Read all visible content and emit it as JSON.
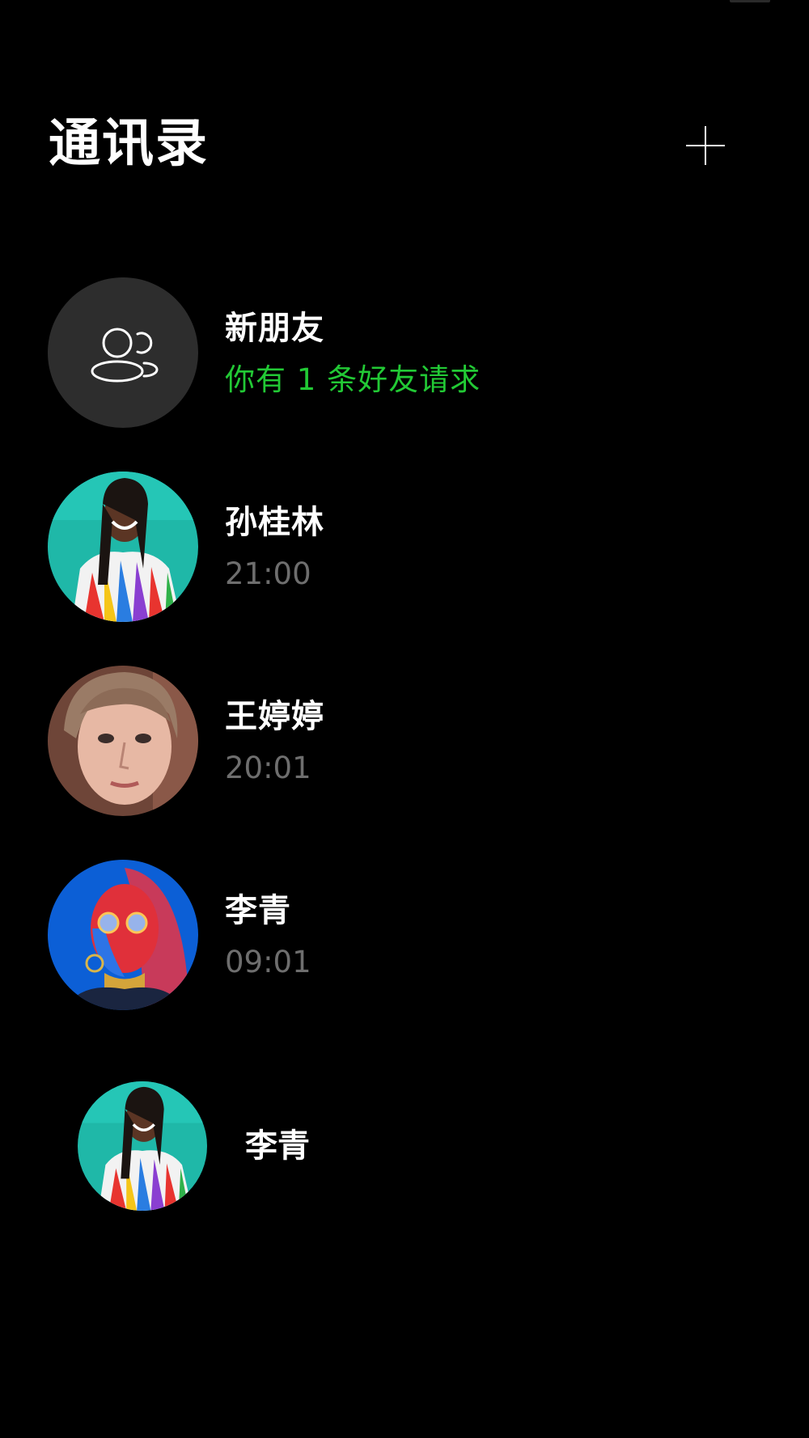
{
  "header": {
    "title": "通讯录",
    "add_button_icon": "plus-icon"
  },
  "new_friends": {
    "icon": "people-icon",
    "name": "新朋友",
    "subtitle": "你有 1 条好友请求",
    "subtitle_color": "#22c935"
  },
  "contacts": [
    {
      "name": "孙桂林",
      "time": "21:00"
    },
    {
      "name": "王婷婷",
      "time": "20:01"
    },
    {
      "name": "李青",
      "time": "09:01"
    }
  ],
  "dragging_contact": {
    "name": "李青"
  },
  "colors": {
    "background": "#000000",
    "text": "#ffffff",
    "secondary_text": "#6e6e6e",
    "accent": "#22c935"
  }
}
